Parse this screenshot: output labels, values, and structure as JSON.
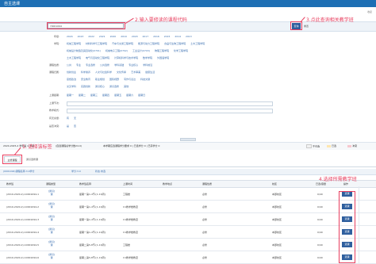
{
  "app": {
    "title": "自主选课"
  },
  "search": {
    "value": "?0001094",
    "button": "查询",
    "reset": "重置"
  },
  "side_link": "收起",
  "annotations": {
    "a1": "1. 选择该标签",
    "a2": "2.输入要修读的课程代码",
    "a3": "3.点此查询相关教学班",
    "a4": "4.选择所需教学班"
  },
  "filters": [
    {
      "label": "年级:",
      "options": [
        "2024",
        "2023",
        "2022",
        "2021",
        "2020",
        "2019",
        "2018",
        "2017",
        "2016",
        "2015",
        "2014",
        "2013"
      ]
    },
    {
      "label": "学院:",
      "options": [
        "机械工程学院",
        "材料科学与工程学院",
        "汽车与交通工程学院",
        "能源与动力工程学院",
        "食品与生物工程学院",
        "土木工程学院"
      ]
    },
    {
      "label": "",
      "options": [
        "机械设计制造及其自动化(0701)",
        "机械电子工程(0702)",
        "工业设计(0703)",
        "物理工程学院",
        "化学工程学院"
      ]
    },
    {
      "label": "",
      "options": [
        "土木工程学院",
        "电气与自动化工程学院",
        "计算机科学与技术学院",
        "数学学院",
        "外国语学院"
      ]
    },
    {
      "label": "课程性质:",
      "options": [
        "公共",
        "专业",
        "专业选修",
        "公共选修",
        "学科基础",
        "专业核心",
        "学科前沿"
      ]
    },
    {
      "label": "课程归属:",
      "options": [
        "创新创业",
        "科学素养",
        "人文与社会科学",
        "文化传承",
        "艺术审美",
        "健康生活"
      ]
    },
    {
      "label": "",
      "options": [
        "思想政治",
        "安全教育",
        "职业规划",
        "国际视野",
        "写作与表达",
        "科技文献"
      ]
    },
    {
      "label": "",
      "options": [
        "交叉学科",
        "实践创新",
        "通识核心",
        "通识选修",
        "其他"
      ]
    },
    {
      "label": "上课星期:",
      "options": [
        "星期一",
        "星期二",
        "星期三",
        "星期四",
        "星期五",
        "星期六",
        "星期日"
      ]
    },
    {
      "label": "上课节次:",
      "options": []
    },
    {
      "label": "教学模式:",
      "options": []
    },
    {
      "label": "有无余量:",
      "options": [
        "有",
        "无"
      ]
    },
    {
      "label": "是否冲突:",
      "options": [
        "是",
        "否"
      ]
    }
  ],
  "stats": {
    "left": "2024-2025-2 学年第 2 学期",
    "middle": "(自选课程总学分数24.0)",
    "right": "本学期应选课程学分要求 0 | 已选学分 0 | 已获学分 0"
  },
  "legend": [
    {
      "label": "不可选",
      "color": "#f2f2f2"
    },
    {
      "label": "已选",
      "color": "#ffe7b0"
    },
    {
      "label": "冲突",
      "color": "#f7c8cf"
    }
  ],
  "tabs": {
    "active": "主修课程",
    "other": "通识选修课"
  },
  "list_header": {
    "course": "(0001094)课程名称-3.0学分",
    "credits": "学分:3.0",
    "status": "状态:未选"
  },
  "table": {
    "headers": [
      "教学班",
      "课程类型",
      "教学班名称",
      "上课时间",
      "教学地点",
      "课程性质",
      "校区",
      "已选/容量",
      "操作"
    ],
    "rows": [
      {
        "code": "(2019-2020-2)-10001094-1",
        "ctype": "[通识]课",
        "tt": "星期一第1-4节{1-16周}",
        "tc": "工程楼",
        "nat": "必修",
        "camp": "本部校区",
        "cap": "0/40",
        "btn": "选课"
      },
      {
        "code": "(2019-2020-2)-10001094-2",
        "ctype": "[通识]课",
        "tt": "星期一第1-4节{1-16周}",
        "tc": "C1教学楼教室",
        "nat": "必修",
        "camp": "本部校区",
        "cap": "0/40",
        "btn": "选课"
      },
      {
        "code": "(2019-2020-2)-10001094-3",
        "ctype": "[通识]课",
        "tt": "星期一第1-4节{1-16周}",
        "tc": "C1教学楼教室",
        "nat": "必修",
        "camp": "本部校区",
        "cap": "0/40",
        "btn": "选课"
      },
      {
        "code": "(2019-2020-2)-10001094-4",
        "ctype": "[通识]课",
        "tt": "星期一第1-4节{1-16周}",
        "tc": "C1教学楼教室",
        "nat": "必修",
        "camp": "本部校区",
        "cap": "0/40",
        "btn": "选课"
      },
      {
        "code": "(2019-2020-2)-10001094-5",
        "ctype": "[通识]课",
        "tt": "星期二第5-8节{1-16周}",
        "tc": "工程楼",
        "nat": "必修",
        "camp": "本部校区",
        "cap": "0/40",
        "btn": "选课"
      },
      {
        "code": "(2019-2020-2)-10001094-6",
        "ctype": "[通识]课",
        "tt": "星期二第5-8节{1-16周}",
        "tc": "C1教学楼教室",
        "nat": "必修",
        "camp": "本部校区",
        "cap": "0/40",
        "btn": "选课"
      }
    ]
  }
}
